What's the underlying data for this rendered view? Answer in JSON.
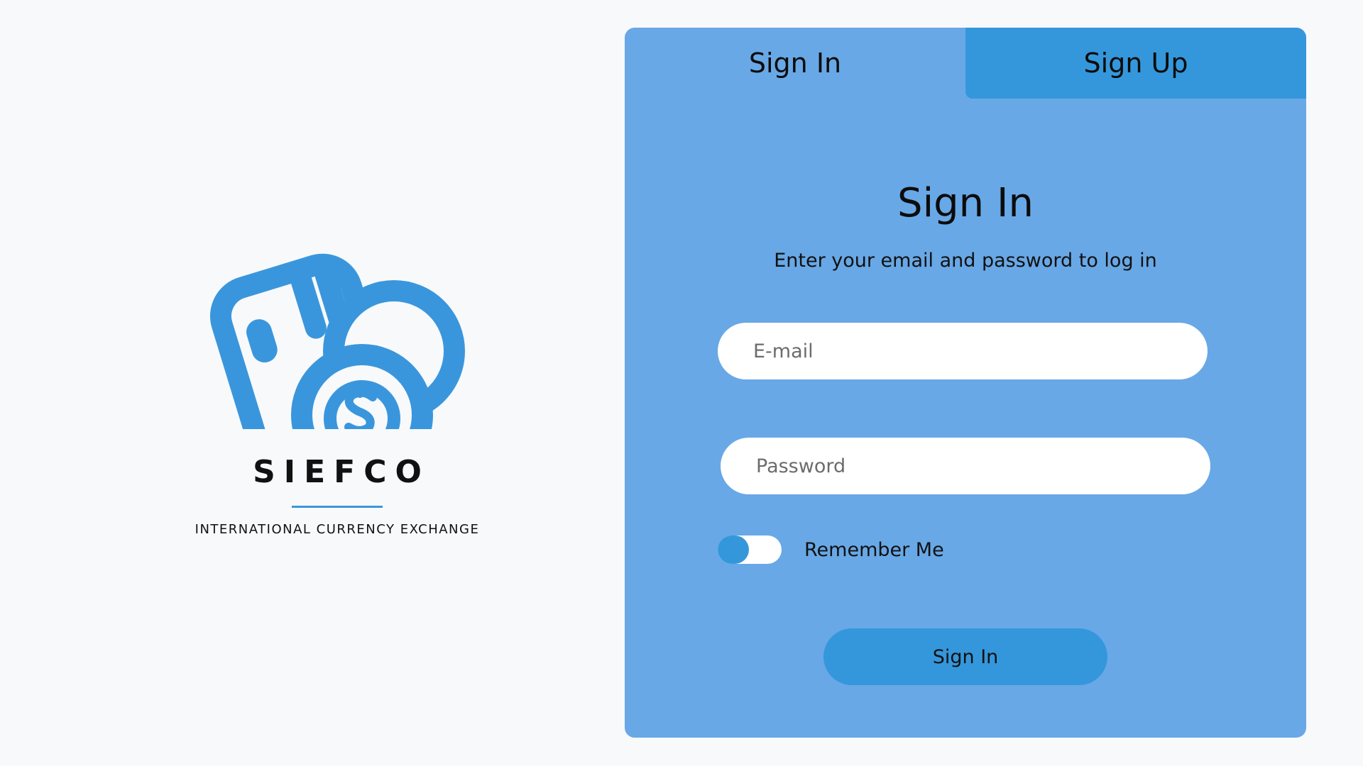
{
  "brand": {
    "name": "SIEFCO",
    "tagline": "INTERNATIONAL CURRENCY EXCHANGE",
    "logo_icon": "card-and-coins-icon",
    "accent_color": "#3a96dc"
  },
  "tabs": [
    {
      "label": "Sign In",
      "active": true
    },
    {
      "label": "Sign Up",
      "active": false
    }
  ],
  "form": {
    "title": "Sign In",
    "subtitle": "Enter your email and password to log in",
    "email": {
      "placeholder": "E-mail",
      "value": ""
    },
    "password": {
      "placeholder": "Password",
      "value": ""
    },
    "remember": {
      "label": "Remember Me",
      "checked": false
    },
    "submit_label": "Sign In"
  },
  "colors": {
    "background": "#f7f9fb",
    "card": "#68a8e6",
    "primary": "#3597db",
    "input": "#ffffff"
  }
}
